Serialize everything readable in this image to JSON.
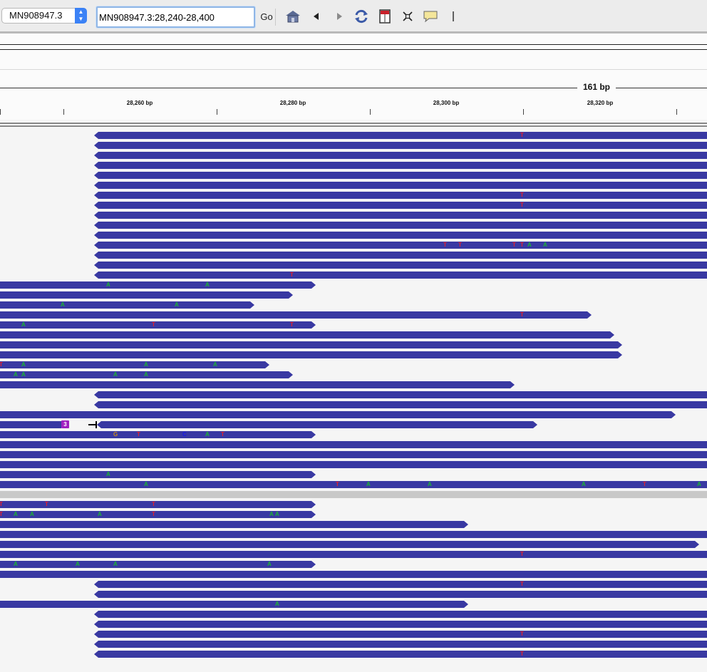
{
  "toolbar": {
    "genome": "MN908947.3",
    "locus": "MN908947.3:28,240-28,400",
    "go_label": "Go",
    "icons": [
      "home-icon",
      "back-icon",
      "forward-icon",
      "refresh-icon",
      "roi-icon",
      "resize-icon",
      "popup-text-icon",
      "divider-icon"
    ]
  },
  "ruler": {
    "span_label": "161 bp",
    "ticks": [
      "28,260 bp",
      "28,280 bp",
      "28,300 bp",
      "28,320 bp"
    ]
  },
  "colors": {
    "read": "#3939a2",
    "A": "#19b531",
    "C": "#1a1ae6",
    "G": "#c88c1a",
    "T": "#e0202e",
    "insertion": "#a020c0"
  },
  "alignments": {
    "mismatch_bases": [
      "A",
      "C",
      "G",
      "T"
    ],
    "insertion_label": "3"
  }
}
